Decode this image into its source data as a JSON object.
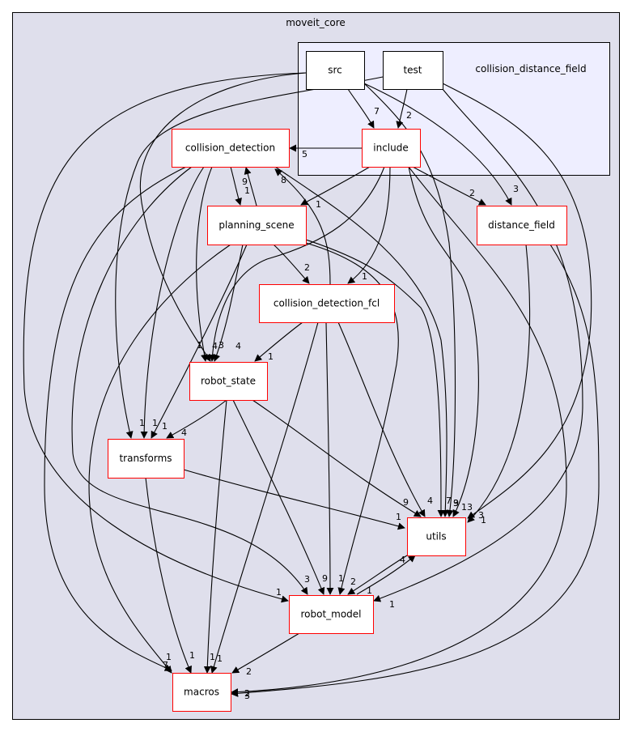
{
  "clusters": {
    "outer": {
      "title": "moveit_core",
      "fill": "#dfdfec"
    },
    "inner": {
      "title": "collision_distance_field",
      "fill": "#eeeeff"
    }
  },
  "colors": {
    "node_border_red": "#ff0000",
    "node_border_black": "#000000",
    "edge": "#000000"
  },
  "nodes": [
    {
      "id": "src",
      "label": "src",
      "border": "black"
    },
    {
      "id": "test",
      "label": "test",
      "border": "black"
    },
    {
      "id": "include",
      "label": "include",
      "border": "red"
    },
    {
      "id": "collision_detection",
      "label": "collision_detection",
      "border": "red"
    },
    {
      "id": "distance_field",
      "label": "distance_field",
      "border": "red"
    },
    {
      "id": "planning_scene",
      "label": "planning_scene",
      "border": "red"
    },
    {
      "id": "collision_detection_fcl",
      "label": "collision_detection_fcl",
      "border": "red"
    },
    {
      "id": "robot_state",
      "label": "robot_state",
      "border": "red"
    },
    {
      "id": "transforms",
      "label": "transforms",
      "border": "red"
    },
    {
      "id": "utils",
      "label": "utils",
      "border": "red"
    },
    {
      "id": "robot_model",
      "label": "robot_model",
      "border": "red"
    },
    {
      "id": "macros",
      "label": "macros",
      "border": "red"
    }
  ],
  "edges": [
    {
      "from": "include",
      "to": "collision_detection",
      "label": "5"
    },
    {
      "from": "src",
      "to": "include",
      "label": "7"
    },
    {
      "from": "test",
      "to": "include",
      "label": "2"
    },
    {
      "from": "include",
      "to": "planning_scene",
      "label": "1"
    },
    {
      "from": "include",
      "to": "distance_field",
      "label": "2"
    },
    {
      "from": "src",
      "to": "distance_field",
      "label": "3"
    },
    {
      "from": "include",
      "to": "collision_detection_fcl",
      "label": "1"
    },
    {
      "from": "include",
      "to": "robot_state",
      "label": "4"
    },
    {
      "from": "collision_detection",
      "to": "planning_scene",
      "label": "1"
    },
    {
      "from": "planning_scene",
      "to": "collision_detection",
      "label": "9"
    },
    {
      "from": "collision_detection_fcl",
      "to": "collision_detection",
      "label": "8"
    },
    {
      "from": "planning_scene",
      "to": "collision_detection_fcl",
      "label": "2"
    },
    {
      "from": "collision_detection_fcl",
      "to": "robot_state",
      "label": "1"
    },
    {
      "from": "collision_detection",
      "to": "robot_state",
      "label": "3"
    },
    {
      "from": "src",
      "to": "robot_state",
      "label": "1"
    },
    {
      "from": "planning_scene",
      "to": "robot_state",
      "label": "4"
    },
    {
      "from": "robot_state",
      "to": "transforms",
      "label": "4"
    },
    {
      "from": "collision_detection",
      "to": "transforms",
      "label": "1"
    },
    {
      "from": "planning_scene",
      "to": "transforms",
      "label": "1"
    },
    {
      "from": "test",
      "to": "transforms",
      "label": "1"
    },
    {
      "from": "transforms",
      "to": "utils",
      "label": "1"
    },
    {
      "from": "robot_state",
      "to": "utils",
      "label": "9"
    },
    {
      "from": "collision_detection_fcl",
      "to": "utils",
      "label": "4"
    },
    {
      "from": "planning_scene",
      "to": "utils",
      "label": "7"
    },
    {
      "from": "collision_detection",
      "to": "utils",
      "label": "9"
    },
    {
      "from": "src",
      "to": "utils",
      "label": "13"
    },
    {
      "from": "include",
      "to": "utils",
      "label": "3"
    },
    {
      "from": "test",
      "to": "utils",
      "label": "3"
    },
    {
      "from": "distance_field",
      "to": "utils",
      "label": "1"
    },
    {
      "from": "utils",
      "to": "robot_model",
      "label": "4"
    },
    {
      "from": "robot_model",
      "to": "utils",
      "label": "1"
    },
    {
      "from": "src",
      "to": "robot_model",
      "label": "1"
    },
    {
      "from": "collision_detection",
      "to": "robot_model",
      "label": "3"
    },
    {
      "from": "robot_state",
      "to": "robot_model",
      "label": "9"
    },
    {
      "from": "collision_detection_fcl",
      "to": "robot_model",
      "label": "1"
    },
    {
      "from": "planning_scene",
      "to": "robot_model",
      "label": "2"
    },
    {
      "from": "test",
      "to": "robot_model",
      "label": "1"
    },
    {
      "from": "robot_model",
      "to": "macros",
      "label": "2"
    },
    {
      "from": "collision_detection",
      "to": "macros",
      "label": "7"
    },
    {
      "from": "planning_scene",
      "to": "macros",
      "label": "1"
    },
    {
      "from": "transforms",
      "to": "macros",
      "label": "1"
    },
    {
      "from": "robot_state",
      "to": "macros",
      "label": "1"
    },
    {
      "from": "collision_detection_fcl",
      "to": "macros",
      "label": "1"
    },
    {
      "from": "include",
      "to": "macros",
      "label": "3"
    },
    {
      "from": "distance_field",
      "to": "macros",
      "label": "2"
    }
  ]
}
